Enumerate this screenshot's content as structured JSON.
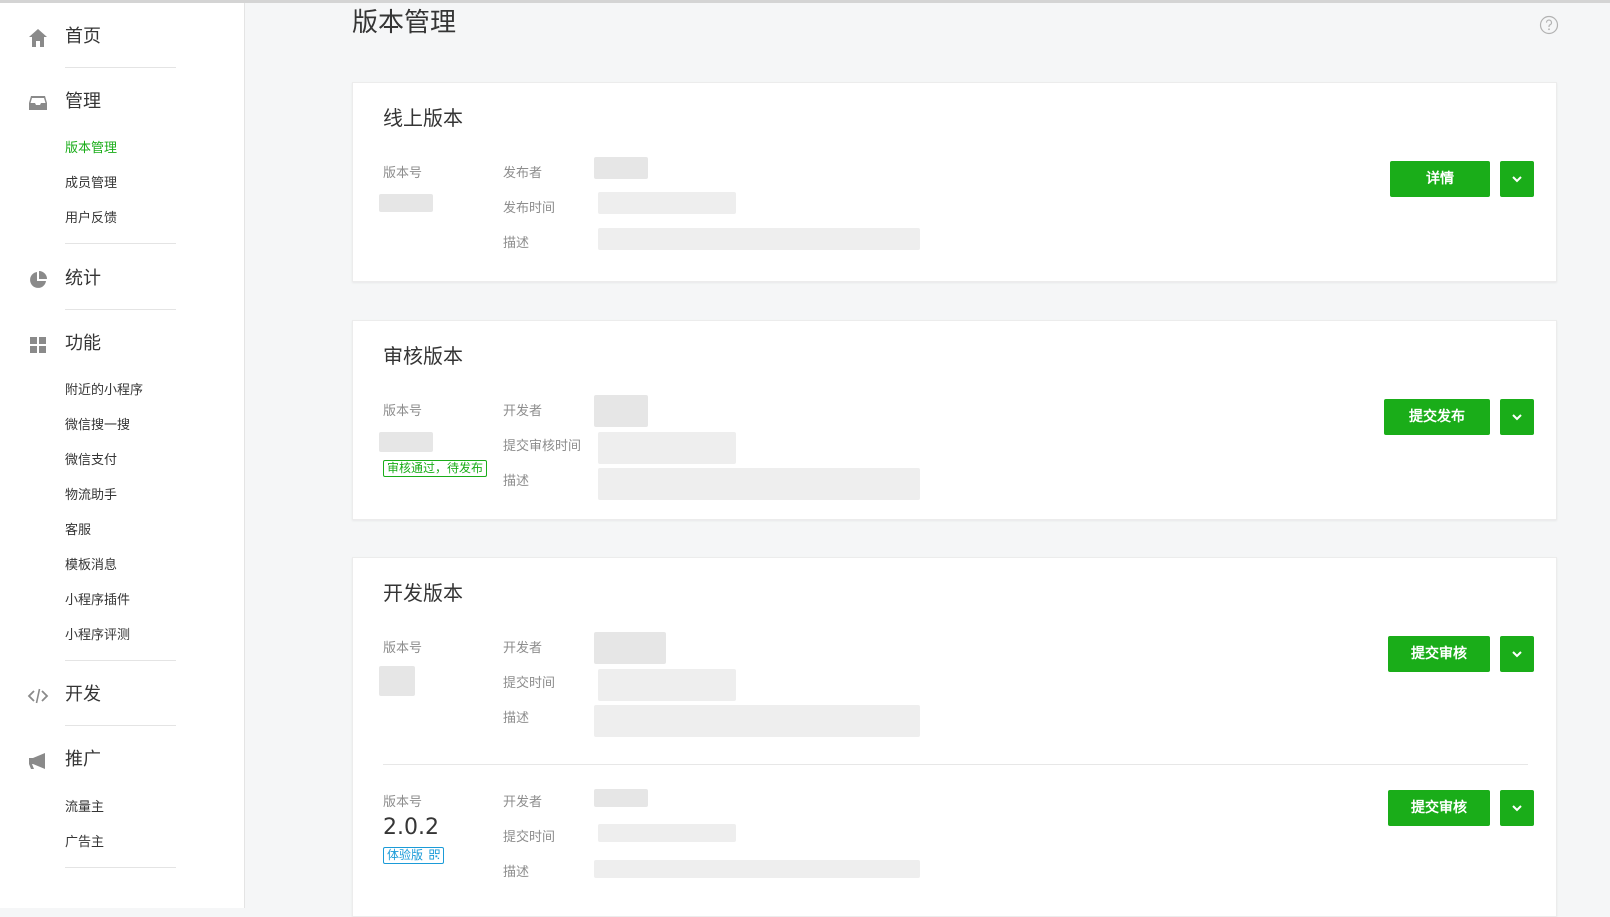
{
  "page": {
    "title": "版本管理",
    "help_icon": "question-circle-icon"
  },
  "sidebar": {
    "home": {
      "label": "首页",
      "icon": "home-icon"
    },
    "manage": {
      "label": "管理",
      "icon": "inbox-icon",
      "items": [
        "版本管理",
        "成员管理",
        "用户反馈"
      ]
    },
    "stats": {
      "label": "统计",
      "icon": "pie-chart-icon"
    },
    "features": {
      "label": "功能",
      "icon": "grid-icon",
      "items": [
        "附近的小程序",
        "微信搜一搜",
        "微信支付",
        "物流助手",
        "客服",
        "模板消息",
        "小程序插件",
        "小程序评测"
      ]
    },
    "dev": {
      "label": "开发",
      "icon": "code-icon"
    },
    "promote": {
      "label": "推广",
      "icon": "megaphone-icon",
      "items": [
        "流量主",
        "广告主"
      ]
    }
  },
  "online": {
    "title": "线上版本",
    "labels": {
      "version": "版本号",
      "publisher": "发布者",
      "time": "发布时间",
      "desc": "描述"
    },
    "button": "详情"
  },
  "review": {
    "title": "审核版本",
    "labels": {
      "version": "版本号",
      "developer": "开发者",
      "time": "提交审核时间",
      "desc": "描述"
    },
    "status_tag": "审核通过，待发布",
    "button": "提交发布"
  },
  "dev": {
    "title": "开发版本",
    "rows": [
      {
        "labels": {
          "version": "版本号",
          "developer": "开发者",
          "time": "提交时间",
          "desc": "描述"
        },
        "version_number": "",
        "button": "提交审核"
      },
      {
        "labels": {
          "version": "版本号",
          "developer": "开发者",
          "time": "提交时间",
          "desc": "描述"
        },
        "version_number": "2.0.2",
        "tag": "体验版",
        "button": "提交审核"
      }
    ]
  },
  "colors": {
    "accent": "#1aad19",
    "trial_tag": "#1b9bd8"
  }
}
